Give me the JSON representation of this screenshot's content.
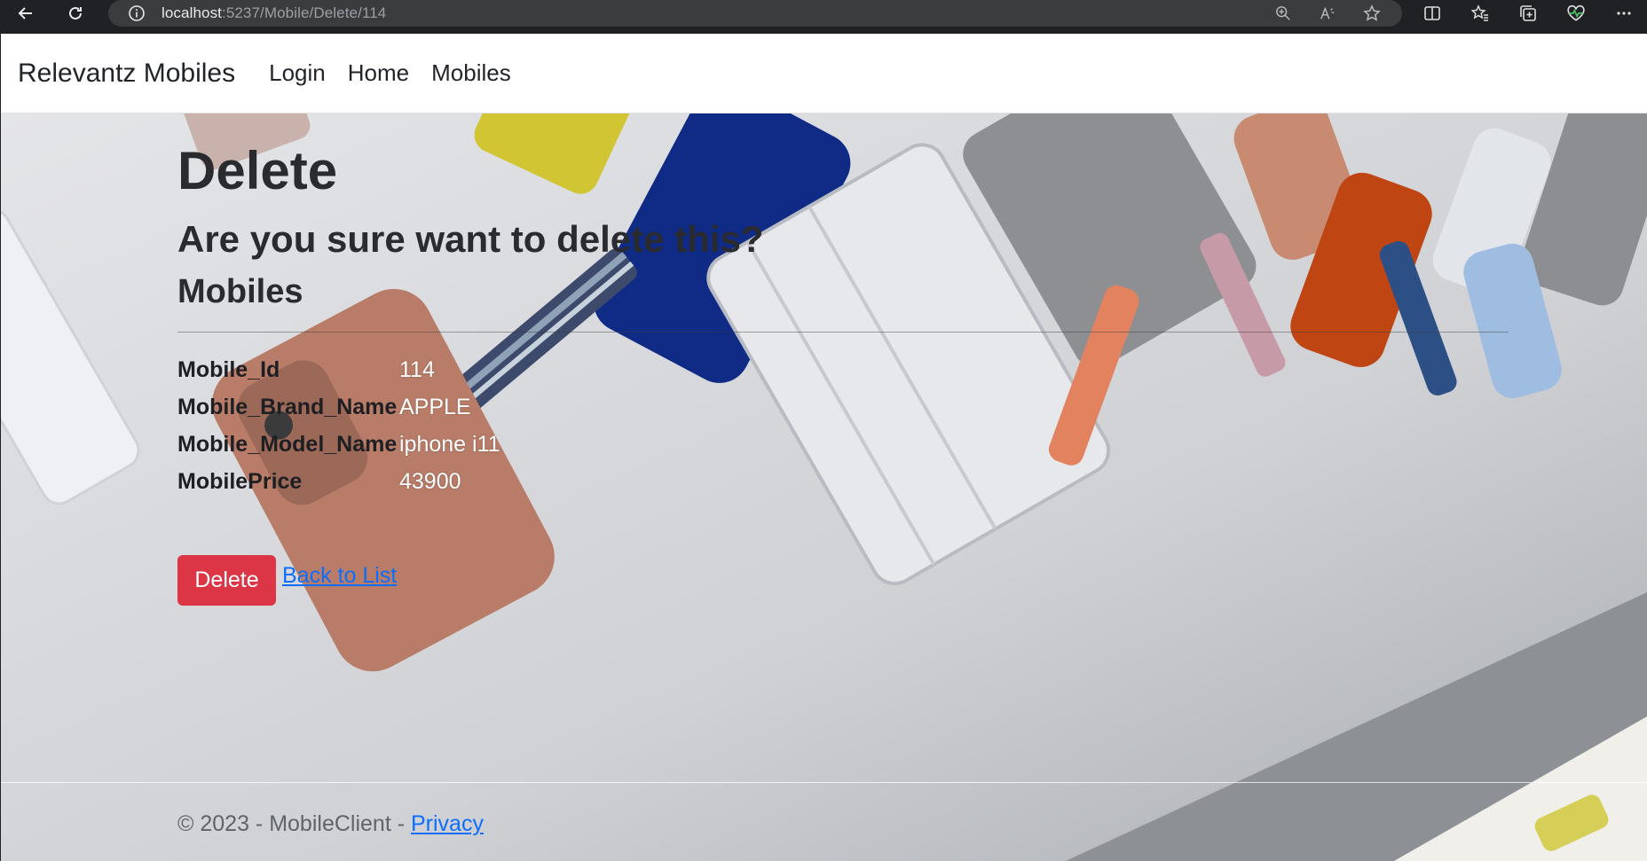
{
  "browser": {
    "url_host": "localhost",
    "url_rest": ":5237/Mobile/Delete/114"
  },
  "navbar": {
    "brand": "Relevantz Mobiles",
    "links": [
      "Login",
      "Home",
      "Mobiles"
    ]
  },
  "page": {
    "title": "Delete",
    "confirm_text": "Are you sure want to delete this?",
    "entity": "Mobiles",
    "fields": [
      {
        "label": "Mobile_Id",
        "value": "114"
      },
      {
        "label": "Mobile_Brand_Name",
        "value": "APPLE"
      },
      {
        "label": "Mobile_Model_Name",
        "value": "iphone i11"
      },
      {
        "label": "MobilePrice",
        "value": "43900"
      }
    ],
    "delete_button": "Delete",
    "back_link": "Back to List"
  },
  "footer": {
    "text": "© 2023 - MobileClient - ",
    "privacy": "Privacy"
  },
  "colors": {
    "danger": "#dc3545",
    "link": "#0d6efd"
  }
}
